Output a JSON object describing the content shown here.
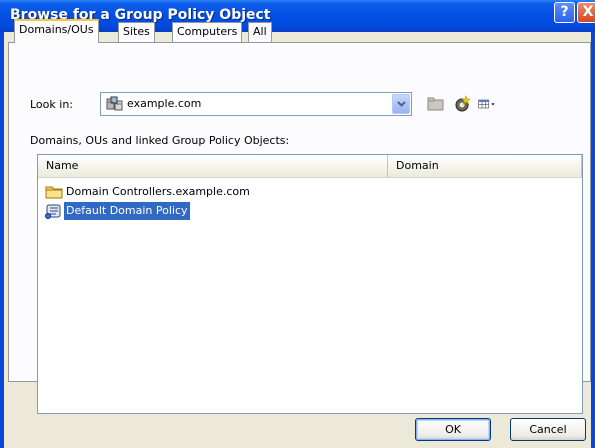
{
  "window": {
    "title": "Browse for a Group Policy Object",
    "help_glyph": "?",
    "close_glyph": "X"
  },
  "tabs": [
    {
      "label": "Domains/OUs",
      "active": true
    },
    {
      "label": "Sites",
      "active": false
    },
    {
      "label": "Computers",
      "active": false
    },
    {
      "label": "All",
      "active": false
    }
  ],
  "look_in": {
    "label": "Look in:",
    "value": "example.com",
    "icon": "domain-icon"
  },
  "toolbar": {
    "icons": [
      "up-folder-icon",
      "new-gpo-icon",
      "view-menu-icon"
    ]
  },
  "list": {
    "caption": "Domains, OUs and linked Group Policy Objects:",
    "columns": [
      "Name",
      "Domain"
    ],
    "rows": [
      {
        "name": "Domain Controllers.example.com",
        "domain": "",
        "icon": "folder-icon",
        "selected": false
      },
      {
        "name": "Default Domain Policy",
        "domain": "",
        "icon": "gpo-scroll-icon",
        "selected": true
      }
    ]
  },
  "buttons": {
    "ok": "OK",
    "cancel": "Cancel"
  },
  "colors": {
    "titlebar": "#0450e6",
    "dialog_bg": "#ece9d8",
    "selection": "#316ac5",
    "active_tab_accent": "#ffc83c"
  }
}
